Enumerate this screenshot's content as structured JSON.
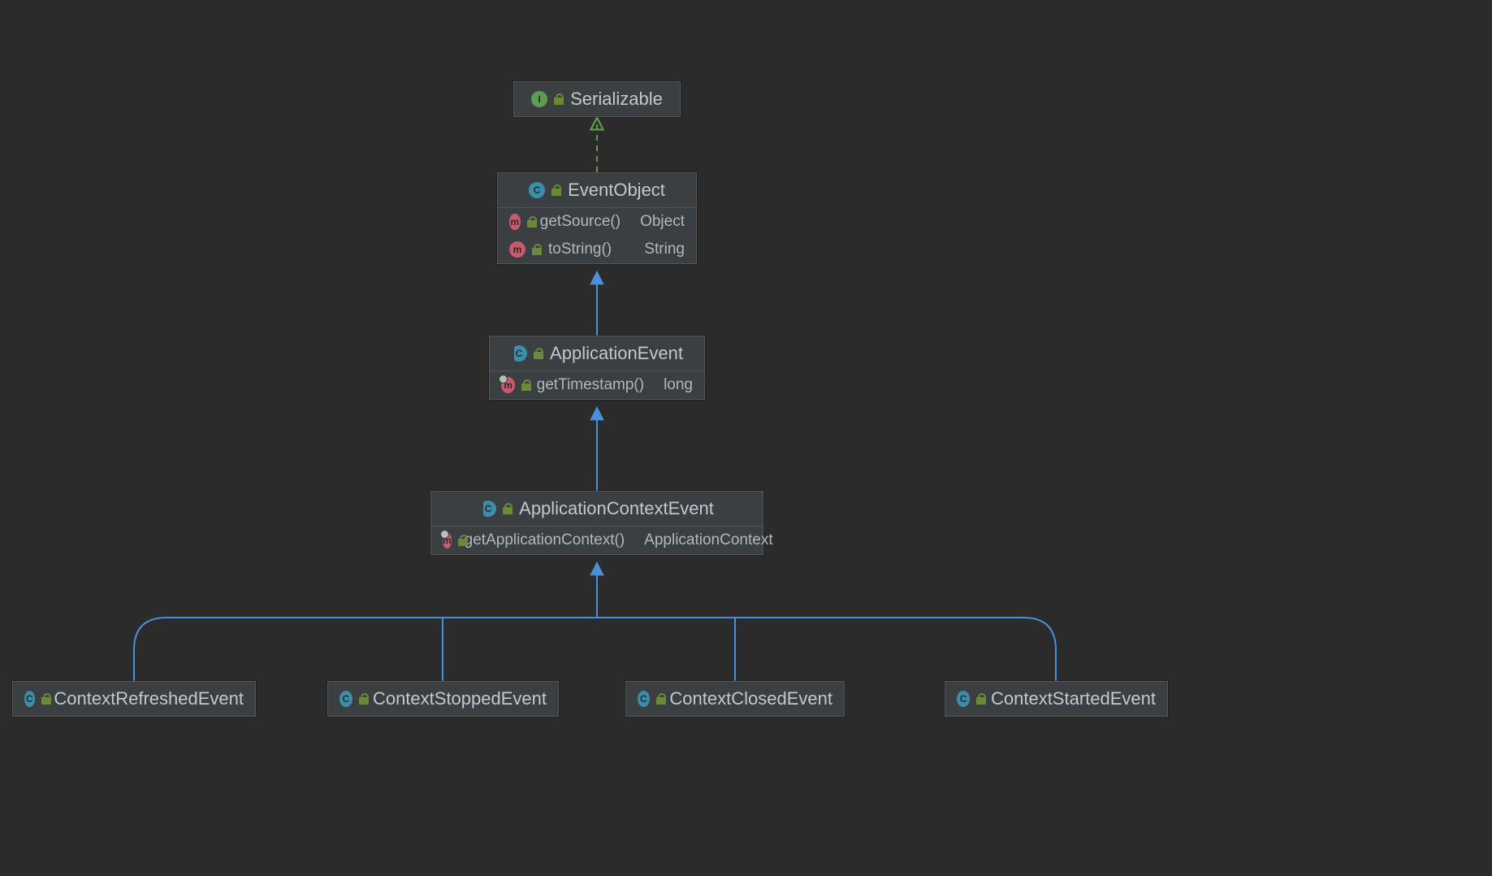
{
  "nodes": {
    "serializable": {
      "name": "Serializable",
      "type": "interface"
    },
    "eventObject": {
      "name": "EventObject",
      "type": "class",
      "methods": [
        {
          "name": "getSource()",
          "returns": "Object"
        },
        {
          "name": "toString()",
          "returns": "String"
        }
      ]
    },
    "applicationEvent": {
      "name": "ApplicationEvent",
      "type": "abstract-class",
      "methods": [
        {
          "name": "getTimestamp()",
          "returns": "long",
          "override": true
        }
      ]
    },
    "applicationContextEvent": {
      "name": "ApplicationContextEvent",
      "type": "abstract-class",
      "methods": [
        {
          "name": "getApplicationContext()",
          "returns": "ApplicationContext",
          "override": true
        }
      ]
    },
    "contextRefreshed": {
      "name": "ContextRefreshedEvent",
      "type": "class"
    },
    "contextStopped": {
      "name": "ContextStoppedEvent",
      "type": "class"
    },
    "contextClosed": {
      "name": "ContextClosedEvent",
      "type": "class"
    },
    "contextStarted": {
      "name": "ContextStartedEvent",
      "type": "class"
    }
  },
  "badges": {
    "interface": "I",
    "class": "C",
    "method": "m"
  },
  "colors": {
    "implements": "#5b9e4d",
    "extends": "#4a90d9"
  }
}
